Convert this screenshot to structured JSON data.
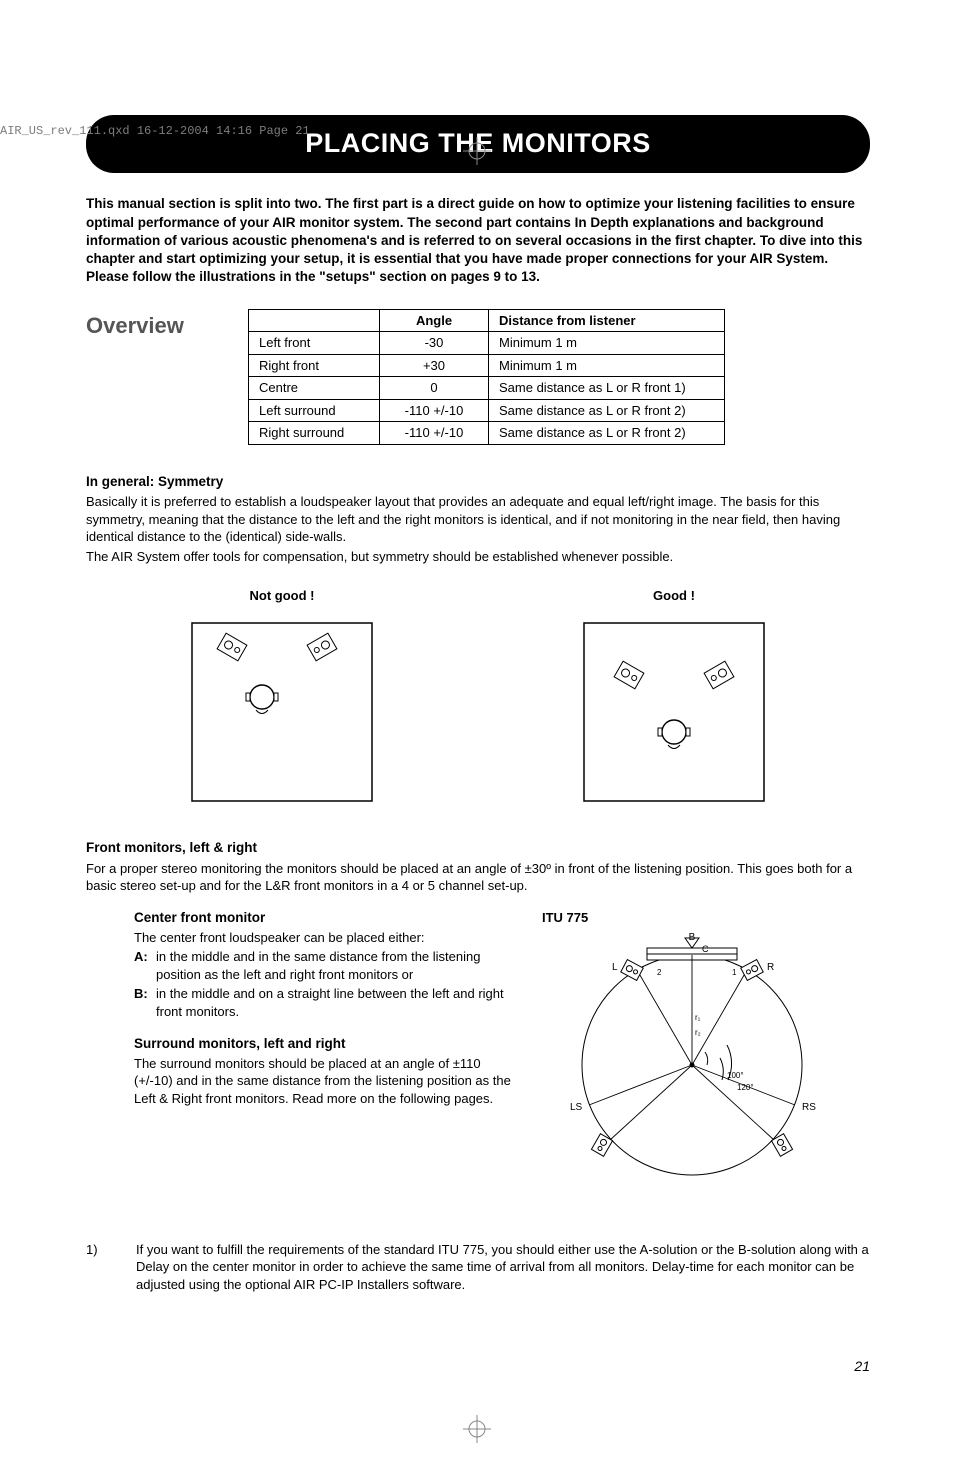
{
  "meta": {
    "print_line": "AIR_US_rev_111.qxd  16-12-2004  14:16  Page 21",
    "page_number": "21"
  },
  "title": "PLACING THE MONITORS",
  "intro": "This manual section is split into two. The first part is a direct guide on how to optimize your listening facilities to ensure optimal performance of your AIR monitor system. The second part contains In Depth explanations and background information of various acoustic phenomena's and is referred to on several occasions in the first chapter. To dive into this chapter and start optimizing your setup, it is essential that you have made proper connections for your AIR System. Please follow the illustrations in the \"setups\" section on pages 9 to 13.",
  "overview_label": "Overview",
  "table": {
    "head": {
      "c1": "",
      "c2": "Angle",
      "c3": "Distance from listener"
    },
    "rows": [
      {
        "c1": "Left front",
        "c2": "-30",
        "c3": "Minimum 1 m"
      },
      {
        "c1": "Right front",
        "c2": "+30",
        "c3": "Minimum 1 m"
      },
      {
        "c1": "Centre",
        "c2": "0",
        "c3": "Same distance as L or R front 1)"
      },
      {
        "c1": "Left surround",
        "c2": "-110 +/-10",
        "c3": "Same distance as L or R front 2)"
      },
      {
        "c1": "Right surround",
        "c2": "-110 +/-10",
        "c3": "Same distance as L or R front 2)"
      }
    ]
  },
  "symmetry": {
    "heading": "In general: Symmetry",
    "p1": "Basically it is preferred to establish a loudspeaker layout that provides an adequate and equal left/right image. The basis for this symmetry, meaning that the distance to the left and the right monitors is identical, and if not monitoring in the near field, then having identical distance to the (identical) side-walls.",
    "p2": "The AIR System offer tools for compensation, but symmetry should be established whenever possible."
  },
  "diagrams": {
    "bad": "Not good !",
    "good": "Good !"
  },
  "front": {
    "heading": "Front monitors, left & right",
    "p1": "For a proper stereo monitoring the monitors should be placed at an angle of ±30º in front of the listening position. This goes both for a basic stereo set-up and for the L&R front monitors in a 4 or 5 channel set-up."
  },
  "center": {
    "heading": "Center front monitor",
    "p1": "The center front loudspeaker can be placed either:",
    "optA_k": "A:",
    "optA_v": "in the middle and in the same distance from the listening position as the left and right front monitors or",
    "optB_k": "B:",
    "optB_v": "in the middle and on a straight line between the left and right front monitors."
  },
  "surround": {
    "heading": "Surround monitors, left and right",
    "p1": "The surround monitors should be placed at an angle of ±110 (+/-10) and in the same distance from the listening position as the Left & Right front monitors. Read more on the following pages."
  },
  "itu": {
    "label": "ITU 775",
    "B": "B",
    "C": "C",
    "L": "L",
    "R": "R",
    "LS": "LS",
    "RS": "RS",
    "ang120": "120°",
    "ang100": "100°",
    "r1": "1",
    "r2": "2",
    "rp1": "r₁",
    "rp2": "r₂"
  },
  "footnote": {
    "num": "1)",
    "text": "If you want to fulfill the requirements of the standard ITU 775, you should either use the A-solution or the B-solution along with a Delay on the center monitor in order to achieve the same time of arrival from all monitors. Delay-time for each monitor can be adjusted using the optional AIR PC-IP Installers software."
  }
}
